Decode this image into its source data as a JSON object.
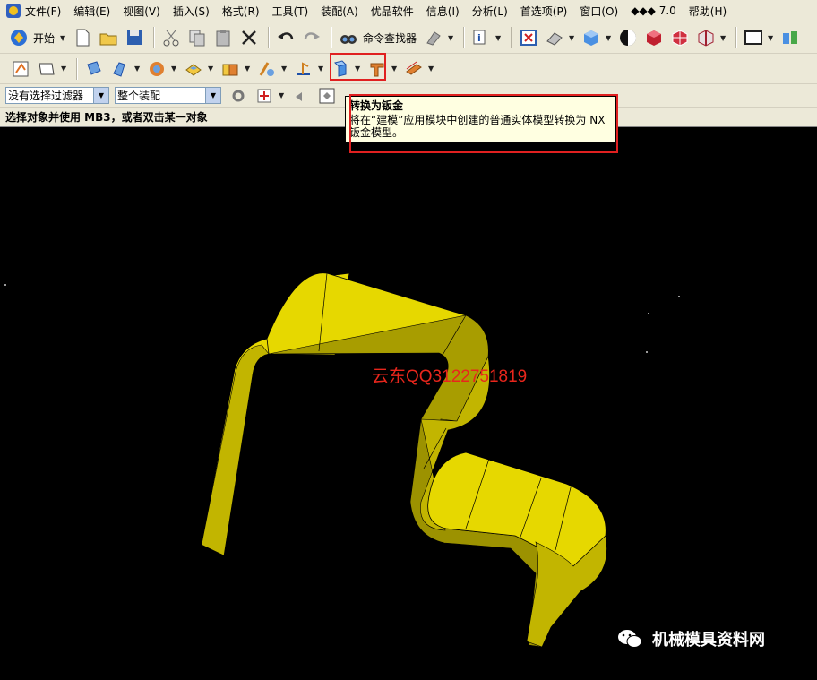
{
  "menubar": {
    "items": [
      "文件(F)",
      "编辑(E)",
      "视图(V)",
      "插入(S)",
      "格式(R)",
      "工具(T)",
      "装配(A)",
      "优品软件",
      "信息(I)",
      "分析(L)",
      "首选项(P)",
      "窗口(O)",
      "◆◆◆ 7.0",
      "帮助(H)"
    ]
  },
  "toolbar1": {
    "start_label": "开始",
    "command_finder_label": "命令查找器"
  },
  "filterbar": {
    "selection_filter": "没有选择过滤器",
    "assembly_scope": "整个装配"
  },
  "status": {
    "prompt": "选择对象并使用 MB3，或者双击某一对象"
  },
  "tooltip": {
    "title": "转换为钣金",
    "body": "将在“建模”应用模块中创建的普通实体模型转换为 NX 钣金模型。"
  },
  "watermarks": {
    "contact": "云东QQ3122751819",
    "brand": "机械模具资料网"
  },
  "colors": {
    "part_top": "#e6d800",
    "part_side": "#a59a00",
    "part_front": "#c2b500",
    "highlight": "#e02020"
  }
}
